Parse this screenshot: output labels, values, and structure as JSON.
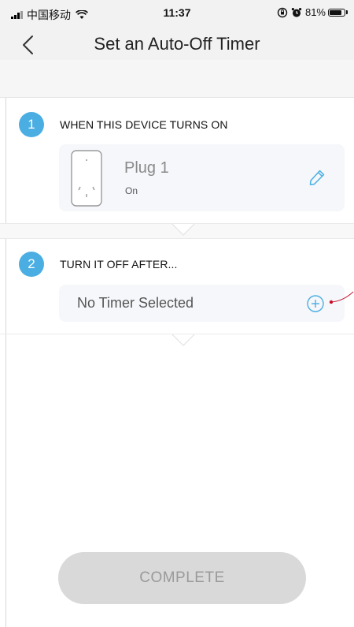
{
  "status_bar": {
    "carrier": "中国移动",
    "time": "11:37",
    "battery_percent": "81%",
    "battery_level": 0.81,
    "icons": [
      "signal-icon",
      "wifi-icon",
      "orientation-lock-icon",
      "alarm-icon",
      "battery-icon"
    ]
  },
  "nav": {
    "title": "Set an Auto-Off Timer",
    "back_icon": "chevron-left-icon"
  },
  "step1": {
    "number": "1",
    "title": "WHEN THIS DEVICE TURNS ON",
    "device": {
      "name": "Plug 1",
      "status": "On",
      "icon": "smart-plug-icon",
      "edit_icon": "pencil-icon"
    }
  },
  "step2": {
    "number": "2",
    "title": "TURN IT OFF AFTER...",
    "timer_placeholder": "No Timer Selected",
    "add_icon": "plus-circle-icon"
  },
  "complete_button": "COMPLETE",
  "colors": {
    "accent": "#4aaee3",
    "button_disabled": "#d9d9d9",
    "button_text": "#9a9a9a",
    "card_bg": "#f5f7fa",
    "annotation": "#c8102e"
  }
}
